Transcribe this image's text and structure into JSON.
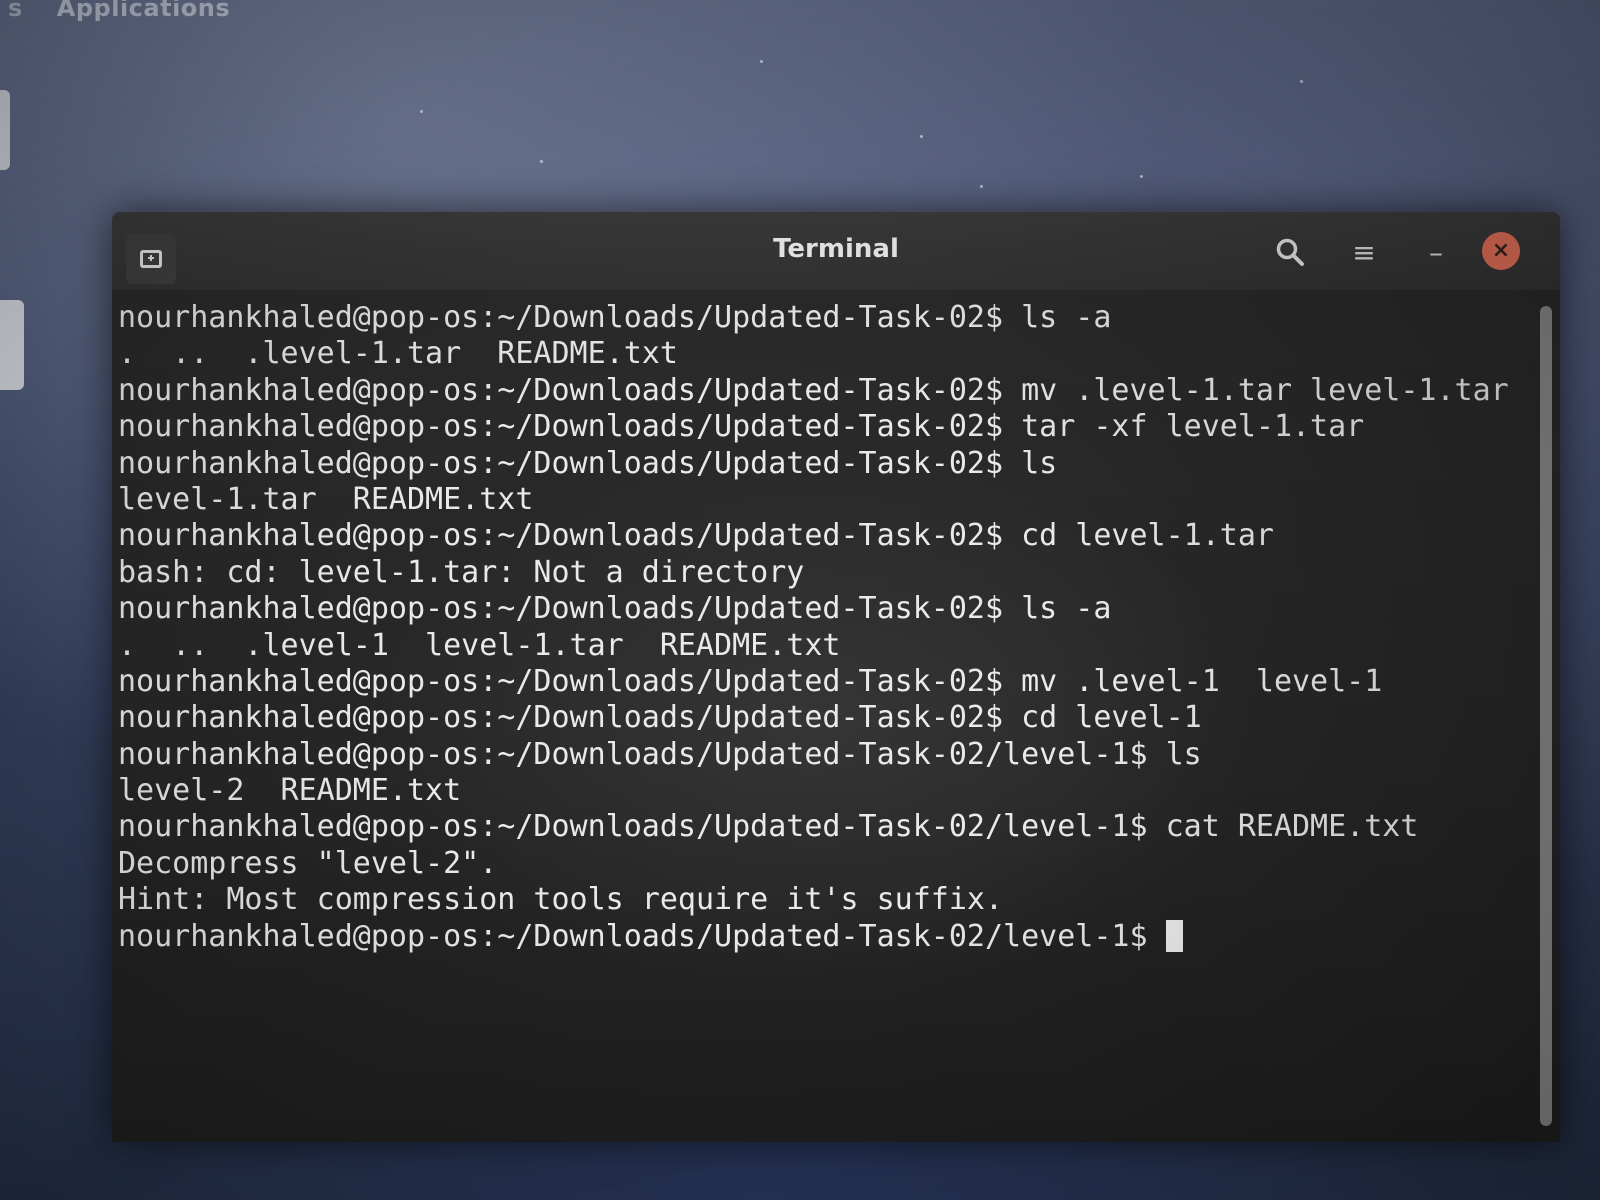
{
  "top_bar": {
    "left_fragment": "s",
    "applications_label": "Applications"
  },
  "window": {
    "title": "Terminal",
    "icons": {
      "new_tab": "new-tab-icon",
      "search": "search-icon",
      "menu": "hamburger-menu-icon",
      "minimize": "minimize-icon",
      "close": "close-icon"
    },
    "menu_glyph": "≡",
    "minimize_glyph": "–",
    "close_glyph": "×",
    "close_color": "#e8725a"
  },
  "terminal": {
    "lines": [
      "nourhankhaled@pop-os:~/Downloads/Updated-Task-02$ ls -a",
      ".  ..  .level-1.tar  README.txt",
      "nourhankhaled@pop-os:~/Downloads/Updated-Task-02$ mv .level-1.tar level-1.tar",
      "nourhankhaled@pop-os:~/Downloads/Updated-Task-02$ tar -xf level-1.tar",
      "nourhankhaled@pop-os:~/Downloads/Updated-Task-02$ ls",
      "level-1.tar  README.txt",
      "nourhankhaled@pop-os:~/Downloads/Updated-Task-02$ cd level-1.tar",
      "bash: cd: level-1.tar: Not a directory",
      "nourhankhaled@pop-os:~/Downloads/Updated-Task-02$ ls -a",
      ".  ..  .level-1  level-1.tar  README.txt",
      "nourhankhaled@pop-os:~/Downloads/Updated-Task-02$ mv .level-1  level-1",
      "nourhankhaled@pop-os:~/Downloads/Updated-Task-02$ cd level-1",
      "nourhankhaled@pop-os:~/Downloads/Updated-Task-02/level-1$ ls",
      "level-2  README.txt",
      "nourhankhaled@pop-os:~/Downloads/Updated-Task-02/level-1$ cat README.txt",
      "Decompress \"level-2\".",
      "Hint: Most compression tools require it's suffix.",
      "nourhankhaled@pop-os:~/Downloads/Updated-Task-02/level-1$ "
    ]
  }
}
